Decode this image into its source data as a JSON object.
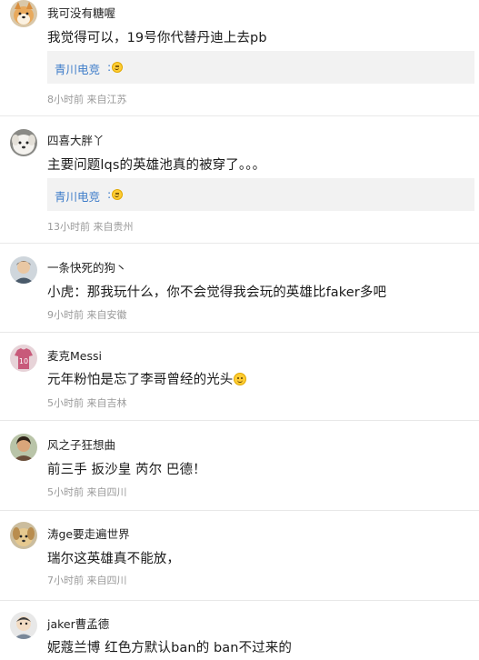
{
  "comments": [
    {
      "username": "我可没有糖喔",
      "text": "我觉得可以，19号你代替丹迪上去pb",
      "reply": {
        "author": "青川电竞",
        "colon": ":",
        "emoji": "laughing-face-emoji"
      },
      "meta": "8小时前 来自江苏",
      "avatar": "shiba-dog-avatar"
    },
    {
      "username": "四喜大胖丫",
      "text": "主要问题lqs的英雄池真的被穿了。。。",
      "reply": {
        "author": "青川电竞",
        "colon": ":",
        "emoji": "laughing-face-emoji"
      },
      "meta": "13小时前 来自贵州",
      "avatar": "white-dog-avatar"
    },
    {
      "username": "一条快死的狗丶",
      "text": "小虎：那我玩什么，你不会觉得我会玩的英雄比faker多吧",
      "meta": "9小时前 来自安徽",
      "avatar": "person-avatar"
    },
    {
      "username": "麦克Messi",
      "text": "元年粉怕是忘了李哥曾经的光头",
      "text_emoji": "laughing-face-emoji",
      "meta": "5小时前 来自吉林",
      "avatar": "jersey-avatar"
    },
    {
      "username": "风之子狂想曲",
      "text": "前三手 扳沙皇 芮尔 巴德！",
      "meta": "5小时前 来自四川",
      "avatar": "person-avatar"
    },
    {
      "username": "涛ge要走遍世界",
      "text": "瑞尔这英雄真不能放，",
      "meta": "7小时前 来自四川",
      "avatar": "puppy-avatar"
    },
    {
      "username": "jaker曹孟德",
      "text": "妮蔻兰博 红色方默认ban的 ban不过来的",
      "avatar": "cartoon-avatar"
    }
  ]
}
